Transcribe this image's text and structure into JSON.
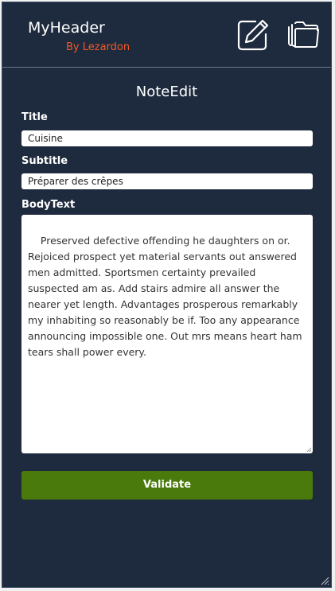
{
  "header": {
    "title": "MyHeader",
    "subtitle": "By Lezardon",
    "edit_icon": "edit-icon",
    "folder_icon": "folders-icon"
  },
  "page": {
    "title": "NoteEdit"
  },
  "form": {
    "title_label": "Title",
    "title_value": "Cuisine",
    "subtitle_label": "Subtitle",
    "subtitle_value": "Préparer des crêpes",
    "body_label": "BodyText",
    "body_value": "Preserved defective offending he daughters on or. Rejoiced prospect yet material servants out answered men admitted. Sportsmen certainty prevailed suspected am as. Add stairs admire all answer the nearer yet length. Advantages prosperous remarkably my inhabiting so reasonably be if. Too any appearance announcing impossible one. Out mrs means heart ham tears shall power every.",
    "validate_label": "Validate"
  },
  "colors": {
    "background": "#1e2a3d",
    "accent": "#f05a28",
    "button": "#4a7a0c"
  }
}
